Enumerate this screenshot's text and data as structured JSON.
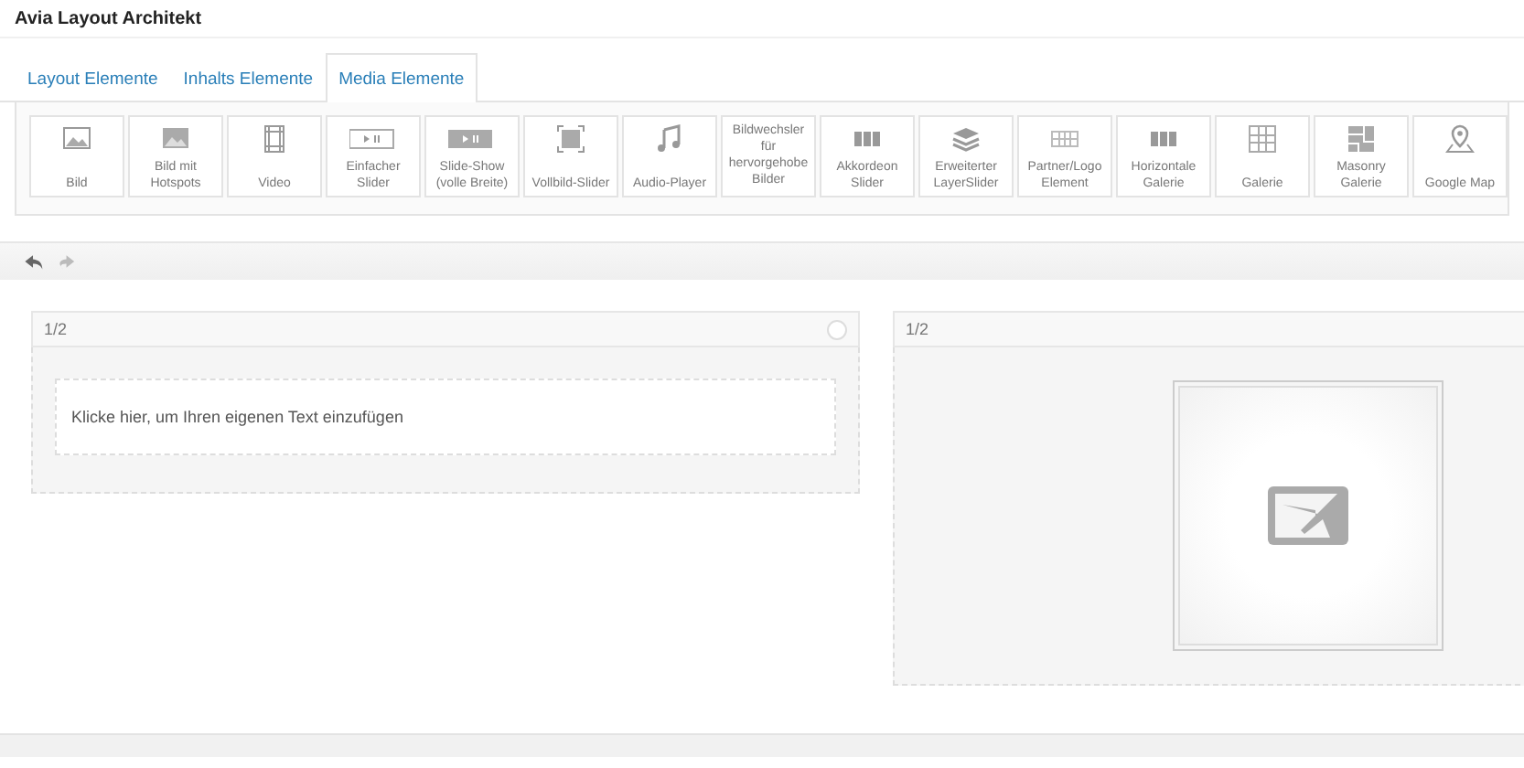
{
  "window": {
    "title": "Avia Layout Architekt"
  },
  "tabs": [
    {
      "label": "Layout Elemente",
      "selected": false
    },
    {
      "label": "Inhalts Elemente",
      "selected": false
    },
    {
      "label": "Media Elemente",
      "selected": true
    }
  ],
  "elements": [
    {
      "label": "Bild",
      "kind": "image"
    },
    {
      "label": "Bild mit Hotspots",
      "kind": "hotspot"
    },
    {
      "label": "Video",
      "kind": "video"
    },
    {
      "label": "Einfacher Slider",
      "kind": "slider"
    },
    {
      "label": "Slide-Show (volle Breite)",
      "kind": "slideshow"
    },
    {
      "label": "Vollbild-Slider",
      "kind": "fullscreen"
    },
    {
      "label": "Audio-Player",
      "kind": "audio"
    },
    {
      "label": "Bildwechsler für hervorgehobe Bilder",
      "kind": "featured"
    },
    {
      "label": "Akkordeon Slider",
      "kind": "accordion"
    },
    {
      "label": "Erweiterter LayerSlider",
      "kind": "layers"
    },
    {
      "label": "Partner/Logo Element",
      "kind": "logos"
    },
    {
      "label": "Horizontale Galerie",
      "kind": "accordion"
    },
    {
      "label": "Galerie",
      "kind": "grid"
    },
    {
      "label": "Masonry Galerie",
      "kind": "masonry"
    },
    {
      "label": "Google Map",
      "kind": "map"
    }
  ],
  "history": {
    "undo": {
      "disabled": false
    },
    "redo": {
      "disabled": true
    }
  },
  "columns": [
    {
      "size": "1/2",
      "kind": "text",
      "content": "Klicke hier, um Ihren eigenen Text einzufügen"
    },
    {
      "size": "1/2",
      "kind": "image"
    }
  ]
}
